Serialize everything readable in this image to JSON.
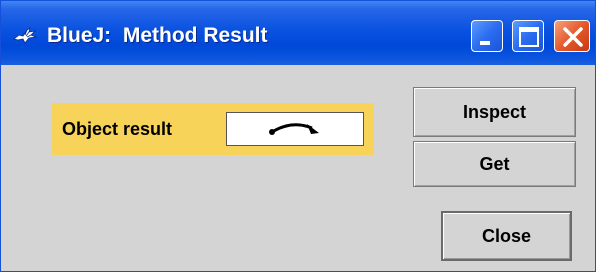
{
  "window": {
    "title": "BlueJ:  Method Result",
    "icon": "bluej-bird-icon"
  },
  "titlebar_buttons": {
    "minimize": "minimize-icon",
    "maximize": "maximize-icon",
    "close": "close-icon"
  },
  "result": {
    "label": "Object result",
    "value_icon": "object-reference-arrow-icon",
    "highlight_color": "#f7d35a"
  },
  "buttons": {
    "inspect_label": "Inspect",
    "get_label": "Get",
    "close_label": "Close"
  },
  "colors": {
    "titlebar": "#0048d8",
    "window_background": "#d4d4d4",
    "close_button": "#e55a2c"
  }
}
